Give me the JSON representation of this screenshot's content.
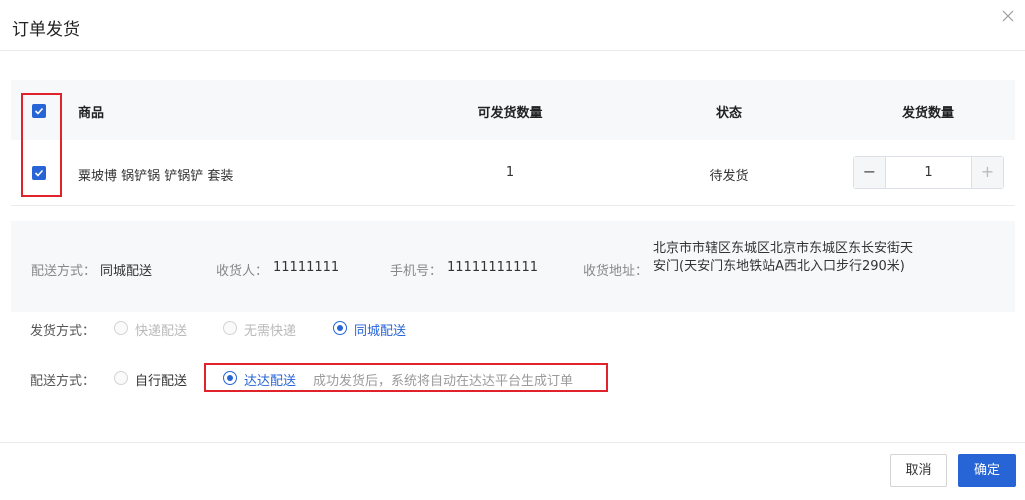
{
  "dialog": {
    "title": "订单发货"
  },
  "table": {
    "headers": {
      "product": "商品",
      "shippable_qty": "可发货数量",
      "status": "状态",
      "ship_qty": "发货数量"
    },
    "rows": [
      {
        "product": "粟坡博 锅铲锅 铲锅铲 套装",
        "shippable_qty": "1",
        "status": "待发货",
        "ship_qty": "1",
        "checked": true
      }
    ],
    "header_checked": true
  },
  "info": {
    "delivery_method_label": "配送方式：",
    "delivery_method_value": "同城配送",
    "receiver_label": "收货人：",
    "receiver_value": "11111111",
    "phone_label": "手机号：",
    "phone_value": "11111111111",
    "address_label": "收货地址：",
    "address_value": "北京市市辖区东城区北京市东城区东长安街天安门(天安门东地铁站A西北入口步行290米)"
  },
  "ship_method": {
    "label": "发货方式：",
    "options": [
      {
        "label": "快递配送",
        "state": "disabled"
      },
      {
        "label": "无需快递",
        "state": "disabled"
      },
      {
        "label": "同城配送",
        "state": "selected"
      }
    ]
  },
  "delivery_mode": {
    "label": "配送方式：",
    "options": [
      {
        "label": "自行配送",
        "state": "unselected"
      },
      {
        "label": "达达配送",
        "state": "selected"
      }
    ],
    "hint": "成功发货后，系统将自动在达达平台生成订单"
  },
  "footer": {
    "cancel_label": "取消",
    "ok_label": "确定"
  },
  "colors": {
    "accent": "#2765d6",
    "highlight_box": "#e0222a"
  }
}
